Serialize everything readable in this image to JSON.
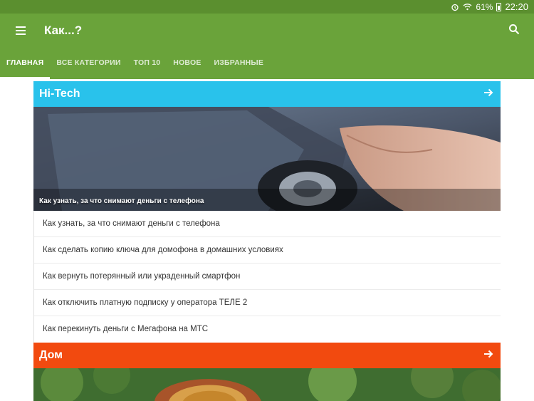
{
  "status_bar": {
    "battery": "61%",
    "time": "22:20",
    "icons": [
      "alarm-icon",
      "wifi-icon",
      "battery-icon"
    ]
  },
  "app": {
    "title": "Как...?",
    "icons": {
      "menu": "menu-icon",
      "search": "search-icon"
    },
    "colors": {
      "primary": "#6aa33a",
      "status": "#5b8f2f"
    }
  },
  "tabs": [
    {
      "label": "ГЛАВНАЯ",
      "active": true
    },
    {
      "label": "ВСЕ КАТЕГОРИИ"
    },
    {
      "label": "ТОП 10"
    },
    {
      "label": "НОВОЕ"
    },
    {
      "label": "ИЗБРАННЫЕ"
    }
  ],
  "sections": [
    {
      "title": "Hi-Tech",
      "color": "#29c2eb",
      "arrow": "arrow-right-icon",
      "hero_caption": "Как узнать, за что снимают деньги с телефона",
      "items": [
        "Как узнать, за что снимают деньги с телефона",
        "Как сделать копию ключа для домофона в домашних условиях",
        "Как вернуть потерянный или украденный смартфон",
        "Как отключить платную подписку у оператора ТЕЛЕ 2",
        "Как перекинуть деньги с Мегафона на МТС"
      ]
    },
    {
      "title": "Дом",
      "color": "#f24a0f",
      "arrow": "arrow-right-icon"
    }
  ]
}
